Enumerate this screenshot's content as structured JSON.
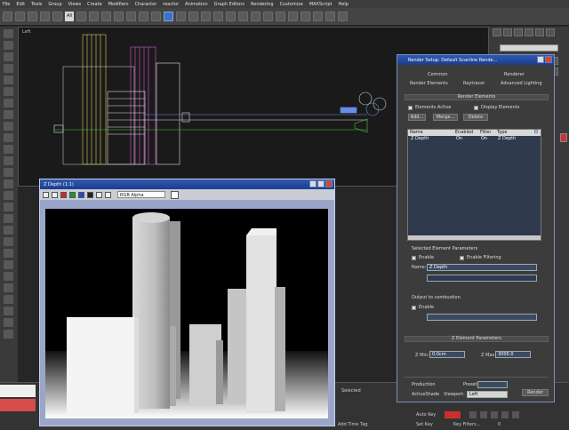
{
  "menubar": {
    "items": [
      "File",
      "Edit",
      "Tools",
      "Group",
      "Views",
      "Create",
      "Modifiers",
      "Character",
      "reactor",
      "Animation",
      "Graph Editors",
      "Rendering",
      "Customize",
      "MAXScript",
      "Help"
    ]
  },
  "toolbar": {
    "selection_filter": "All"
  },
  "viewport": {
    "label": "Left"
  },
  "zdepth_window": {
    "title": "Z Depth (1:1)",
    "channel_select": "RGB Alpha"
  },
  "render_setup": {
    "title": "Render Setup: Default Scanline Rende...",
    "tabs_row1": [
      "Common",
      "Renderer"
    ],
    "tabs_row2": [
      "Render Elements",
      "Raytracer",
      "Advanced Lighting"
    ],
    "rollout_title": "Render Elements",
    "elements_active_label": "Elements Active",
    "display_elements_label": "Display Elements",
    "add_button": "Add...",
    "merge_button": "Merge...",
    "delete_button": "Delete",
    "list_headers": [
      "Name",
      "Enabled",
      "Filter",
      "Type",
      "O"
    ],
    "list_rows": [
      {
        "name": "Z Depth",
        "enabled": "On",
        "filter": "On",
        "type": "Z Depth"
      }
    ],
    "selected_params_title": "Selected Element Parameters",
    "enable_label": "Enable",
    "enable_filtering_label": "Enable Filtering",
    "name_label": "Name:",
    "name_value": "Z Depth",
    "output_label": "Output to combustion",
    "output_enable_label": "Enable",
    "zelement_title": "Z Element Parameters",
    "zmin_label": "Z Min:",
    "zmin_value": "0.0cm",
    "zmax_label": "Z Max:",
    "zmax_value": "3000.0",
    "production_label": "Production",
    "preset_label": "Preset:",
    "activeshade_label": "ActiveShade",
    "viewport_label": "Viewport:",
    "viewport_value": "Left",
    "render_button": "Render"
  },
  "status": {
    "key_filter": "Selected",
    "auto_key": "Auto Key",
    "set_key": "Set Key",
    "key_filters": "Key Filters...",
    "add_time_tag": "Add Time Tag",
    "frame": "0"
  }
}
